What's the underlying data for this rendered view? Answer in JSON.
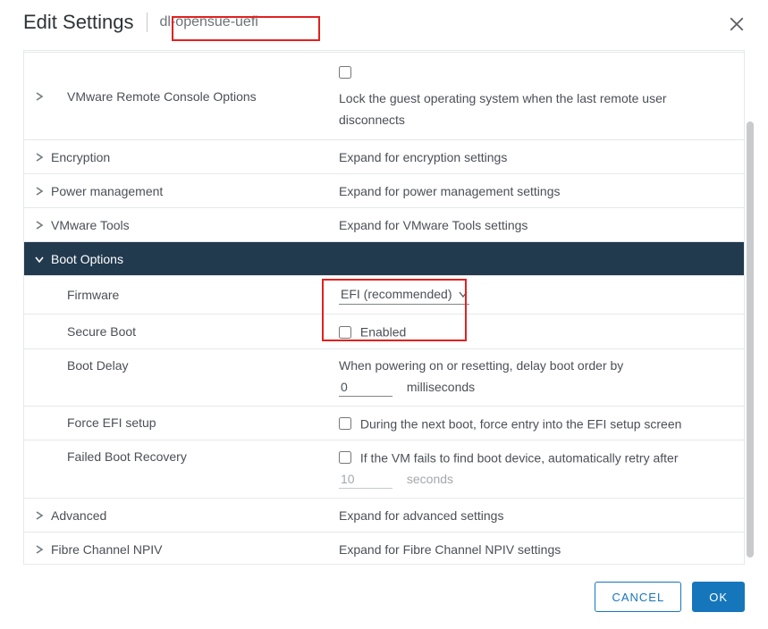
{
  "header": {
    "title": "Edit Settings",
    "vm_name": "dl-opensue-uefi"
  },
  "sections": {
    "remote_console": {
      "label": "VMware Remote Console Options",
      "desc": "Lock the guest operating system when the last remote user disconnects"
    },
    "encryption": {
      "label": "Encryption",
      "desc": "Expand for encryption settings"
    },
    "power": {
      "label": "Power management",
      "desc": "Expand for power management settings"
    },
    "vmtools": {
      "label": "VMware Tools",
      "desc": "Expand for VMware Tools settings"
    },
    "boot": {
      "label": "Boot Options",
      "firmware": {
        "label": "Firmware",
        "value": "EFI (recommended)"
      },
      "secure_boot": {
        "label": "Secure Boot",
        "checkbox_label": "Enabled"
      },
      "boot_delay": {
        "label": "Boot Delay",
        "desc": "When powering on or resetting, delay boot order by",
        "value": "0",
        "unit": "milliseconds"
      },
      "force_efi": {
        "label": "Force EFI setup",
        "checkbox_label": "During the next boot, force entry into the EFI setup screen"
      },
      "failed_boot": {
        "label": "Failed Boot Recovery",
        "checkbox_label": "If the VM fails to find boot device, automatically retry after",
        "value": "10",
        "unit": "seconds"
      }
    },
    "advanced": {
      "label": "Advanced",
      "desc": "Expand for advanced settings"
    },
    "npiv": {
      "label": "Fibre Channel NPIV",
      "desc": "Expand for Fibre Channel NPIV settings"
    }
  },
  "footer": {
    "cancel": "CANCEL",
    "ok": "OK"
  }
}
